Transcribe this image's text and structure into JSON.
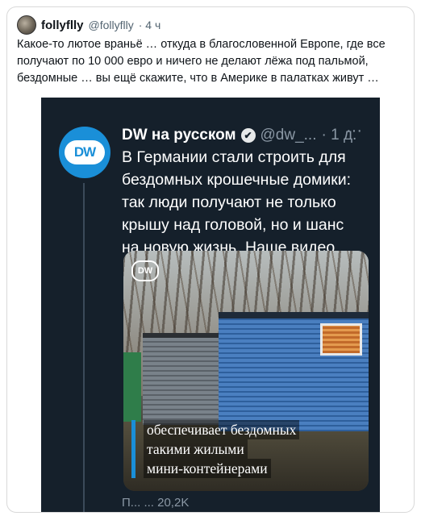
{
  "post": {
    "author_name": "follyflly",
    "author_handle": "@follyflly",
    "time": "· 4 ч",
    "text": "Какое-то лютое враньё … откуда в благословенной Европе, где все получают по 10 000 евро и ничего не делают лёжа под пальмой, бездомные … вы ещё скажите, что в Америке в палатках живут …"
  },
  "quoted_tweet": {
    "logo_text": "DW",
    "name": "DW на русском",
    "verified_symbol": "✔",
    "handle": "@dw_...",
    "time": "· 1 д.",
    "more_icon": "···",
    "text": "В Германии стали строить для бездомных крошечные домики: так люди получают не только крышу над головой, но и шанс на новую жизнь. Наше видео",
    "media": {
      "logo_text": "DW",
      "caption_lines": [
        "обеспечивает бездомных",
        "такими жилыми",
        "мини-контейнерами"
      ]
    },
    "footer_partial": "П... ... 20,2K"
  },
  "colors": {
    "accent": "#1a8fd8",
    "dark_bg": "#15202b"
  }
}
